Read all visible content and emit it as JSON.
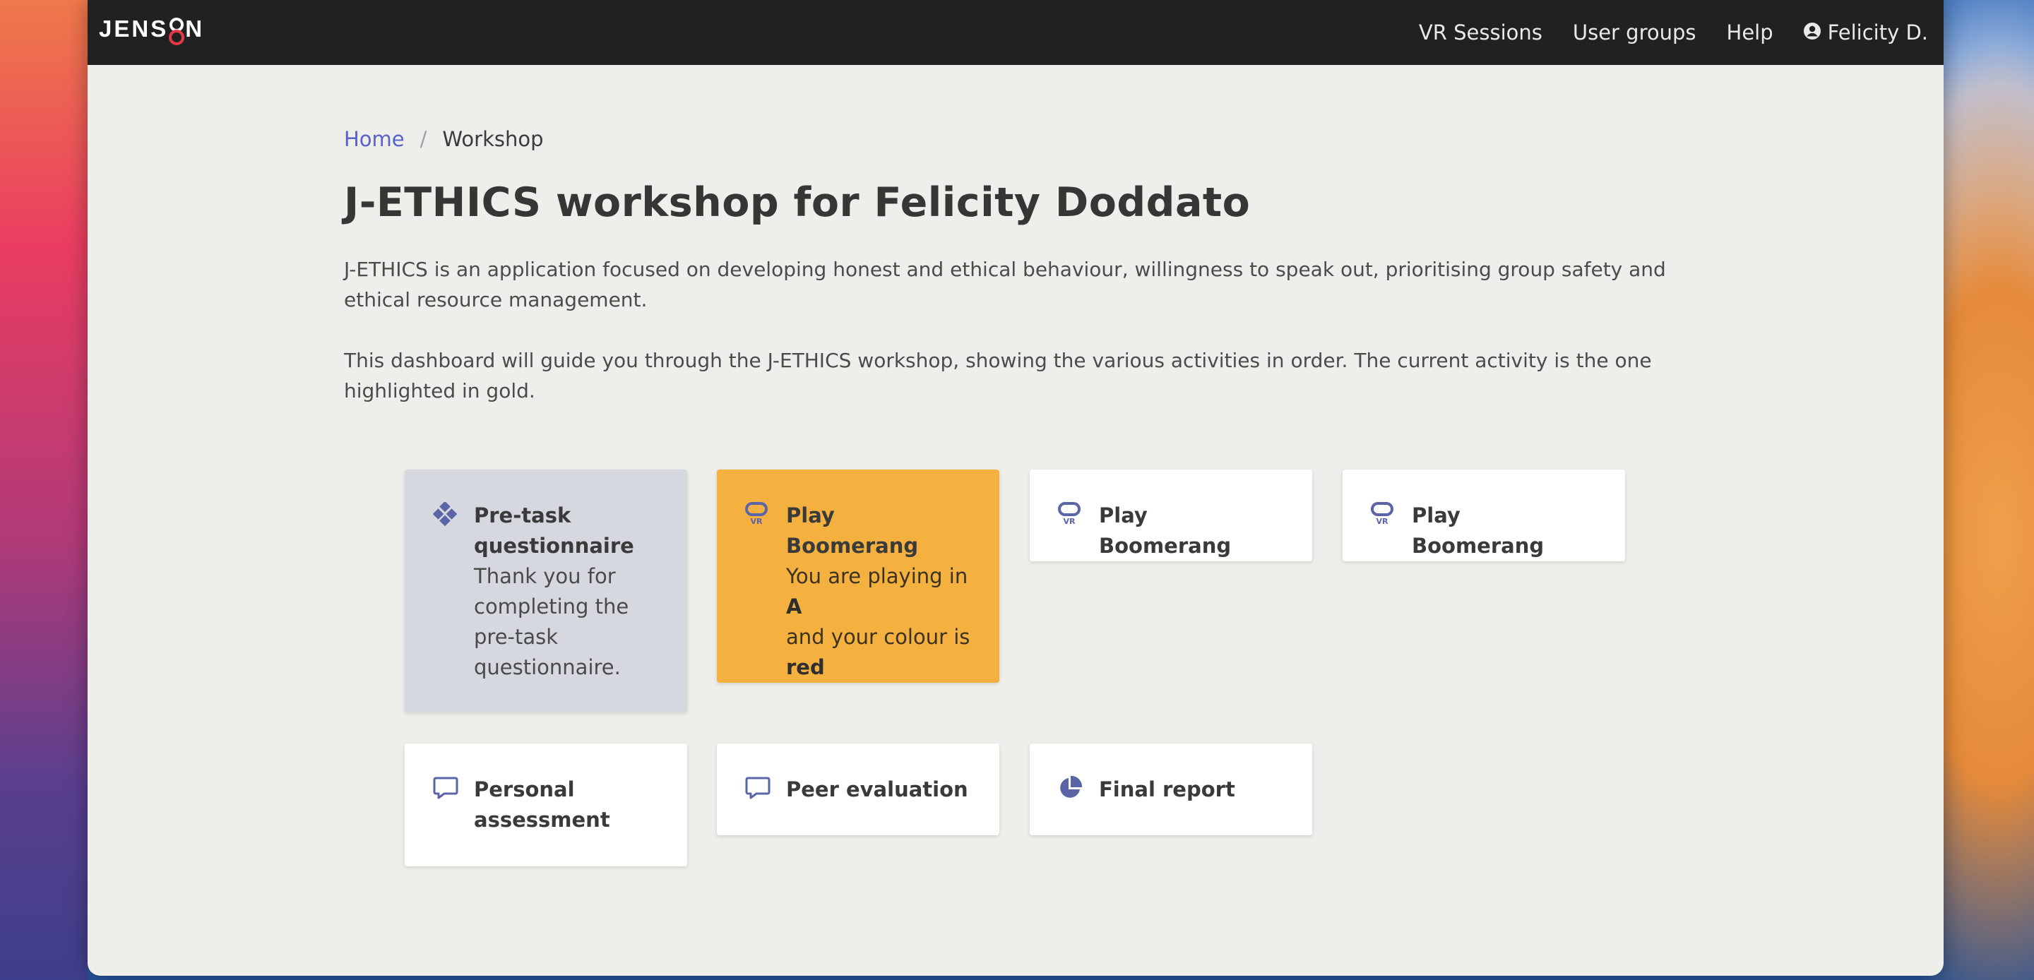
{
  "app": {
    "logo_text_left": "JENS",
    "logo_text_right": "N",
    "logo_accent": "#e53945"
  },
  "nav": {
    "items": [
      {
        "label": "VR Sessions"
      },
      {
        "label": "User groups"
      },
      {
        "label": "Help"
      }
    ],
    "user": {
      "icon": "user-circle-icon",
      "label": "Felicity D."
    }
  },
  "breadcrumb": {
    "home": "Home",
    "separator": "/",
    "current": "Workshop"
  },
  "page": {
    "title": "J-ETHICS workshop for Felicity Doddato",
    "intro": "J-ETHICS is an application focused on developing honest and ethical behaviour, willingness to speak out, prioritising group safety and ethical resource management.",
    "guide": "This dashboard will guide you through the J-ETHICS workshop, showing the various activities in order. The current activity is the one highlighted in gold."
  },
  "colors": {
    "current_activity": "#f4b13f",
    "completed_activity": "#d6d8df",
    "icon_accent": "#5c64a8",
    "link": "#5a62c9"
  },
  "activities": [
    {
      "icon": "puzzle-diamond-icon",
      "title": "Pre-task questionnaire",
      "desc": "Thank you for completing the pre-task questionnaire.",
      "state": "completed"
    },
    {
      "icon": "vr-headset-icon",
      "title": "Play Boomerang",
      "line1": "You are playing in",
      "value1": "A",
      "line2": "and your colour is",
      "value2": "red",
      "state": "current"
    },
    {
      "icon": "vr-headset-icon",
      "title": "Play Boomerang",
      "state": "upcoming"
    },
    {
      "icon": "vr-headset-icon",
      "title": "Play Boomerang",
      "state": "upcoming"
    },
    {
      "icon": "speech-bubble-icon",
      "title": "Personal assessment",
      "state": "upcoming"
    },
    {
      "icon": "speech-bubble-icon",
      "title": "Peer evaluation",
      "state": "upcoming"
    },
    {
      "icon": "pie-chart-icon",
      "title": "Final report",
      "state": "upcoming"
    }
  ]
}
